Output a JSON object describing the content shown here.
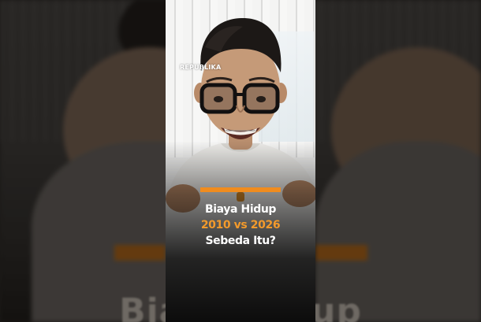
{
  "video": {
    "watermark": "REPUBLIKA",
    "headline": {
      "line1": "Biaya Hidup",
      "line2": "2010 vs 2026",
      "line3": "Sebeda Itu?"
    },
    "background_caption": "Biaya Hidup"
  },
  "colors": {
    "accent": "#f08c1e",
    "highlight_text": "#f39a2b",
    "text": "#ffffff"
  }
}
